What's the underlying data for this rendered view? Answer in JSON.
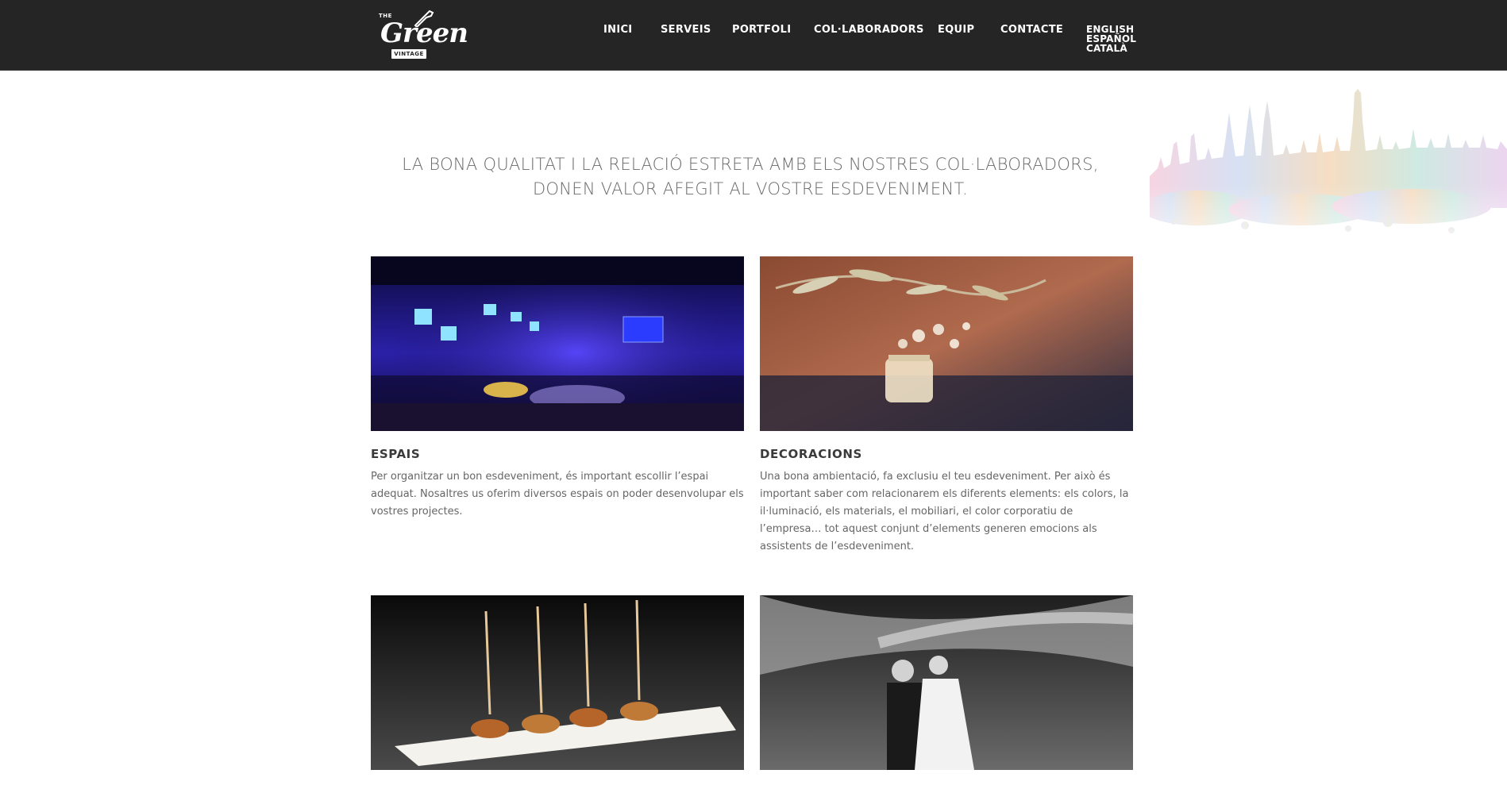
{
  "brand": {
    "the": "THE",
    "name": "Green",
    "ribbon": "VINTAGE"
  },
  "nav": {
    "items": [
      {
        "label": "INICI"
      },
      {
        "label": "SERVEIS"
      },
      {
        "label": "PORTFOLI"
      },
      {
        "label": "COL·LABORADORS"
      },
      {
        "label": "EQUIP"
      },
      {
        "label": "CONTACTE"
      }
    ],
    "languages": [
      "ENGLISH",
      "ESPAÑOL",
      "CATALÀ"
    ]
  },
  "tagline": "LA BONA QUALITAT I LA RELACIÓ ESTRETA AMB ELS NOSTRES COL·LABORADORS, DONEN VALOR AFEGIT AL VOSTRE ESDEVENIMENT.",
  "cards": [
    {
      "title": "ESPAIS",
      "text": "Per organitzar un bon esdeveniment, és important escollir l’espai adequat. Nosaltres us oferim diversos espais on poder desenvolupar els vostres projectes."
    },
    {
      "title": "DECORACIONS",
      "text": "Una bona ambientació, fa exclusiu el teu esdeveniment. Per això és important saber com relacionarem els diferents elements: els colors, la il·luminació, els materials, el mobiliari, el color corporatiu de l’empresa… tot aquest conjunt d’elements generen emocions als assistents de l’esdeveniment."
    }
  ],
  "colors": {
    "header": "#252525",
    "text": "#666666",
    "title": "#3a3a3a"
  }
}
